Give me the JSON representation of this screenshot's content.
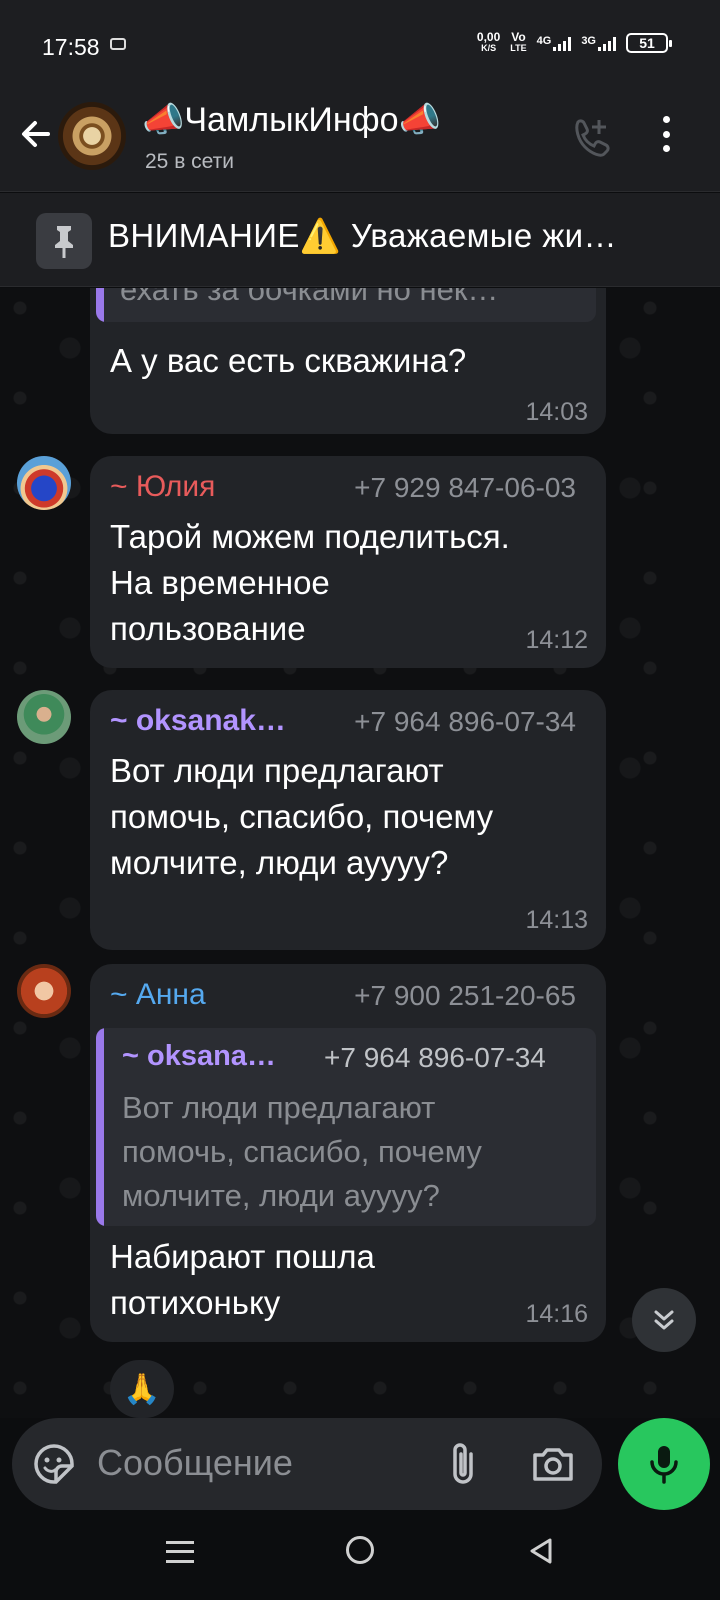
{
  "status_bar": {
    "time": "17:58",
    "net_speed_value": "0,00",
    "net_speed_unit": "K/S",
    "volte_top": "Vo",
    "volte_bottom": "LTE",
    "network_1": "4G",
    "network_2": "3G",
    "battery": "51"
  },
  "header": {
    "title": "📣ЧамлыкИнфо📣",
    "subtitle": "25 в сети"
  },
  "pinned": {
    "text": "ВНИМАНИЕ⚠️ Уважаемые жи…"
  },
  "messages": [
    {
      "reply_snippet": "ехать за бочками но нек…",
      "text": "А у вас есть скважина?",
      "time": "14:03"
    },
    {
      "sender": "~ Юлия",
      "sender_color": "#e85b5b",
      "phone": "+7 929 847-06-03",
      "text_lines": [
        "Тарой можем поделиться.",
        "На временное",
        "пользование"
      ],
      "time": "14:12"
    },
    {
      "sender": "~ oksanak…",
      "sender_color": "#b294ff",
      "phone": "+7 964 896-07-34",
      "text_lines": [
        "Вот люди предлагают",
        "помочь, спасибо, почему",
        "молчите, люди ауууу?"
      ],
      "time": "14:13"
    },
    {
      "sender": "~ Анна",
      "sender_color": "#55a9ef",
      "phone": "+7 900 251-20-65",
      "reply": {
        "sender": "~ oksana…",
        "phone": "+7 964 896-07-34",
        "lines": [
          "Вот люди предлагают",
          "помочь, спасибо, почему",
          "молчите, люди ауууу?"
        ]
      },
      "text_lines": [
        "Набирают пошла",
        "потихоньку"
      ],
      "time": "14:16"
    }
  ],
  "reaction": "🙏",
  "input": {
    "placeholder": "Сообщение"
  },
  "colors": {
    "accent_green": "#28c75e",
    "bubble": "#222428"
  },
  "icons": [
    "back-arrow-icon",
    "add-call-icon",
    "more-icon",
    "pin-icon",
    "sticker-icon",
    "attach-icon",
    "camera-icon",
    "mic-icon",
    "scroll-down-icon",
    "nav-menu-icon",
    "nav-home-icon",
    "nav-back-icon"
  ]
}
